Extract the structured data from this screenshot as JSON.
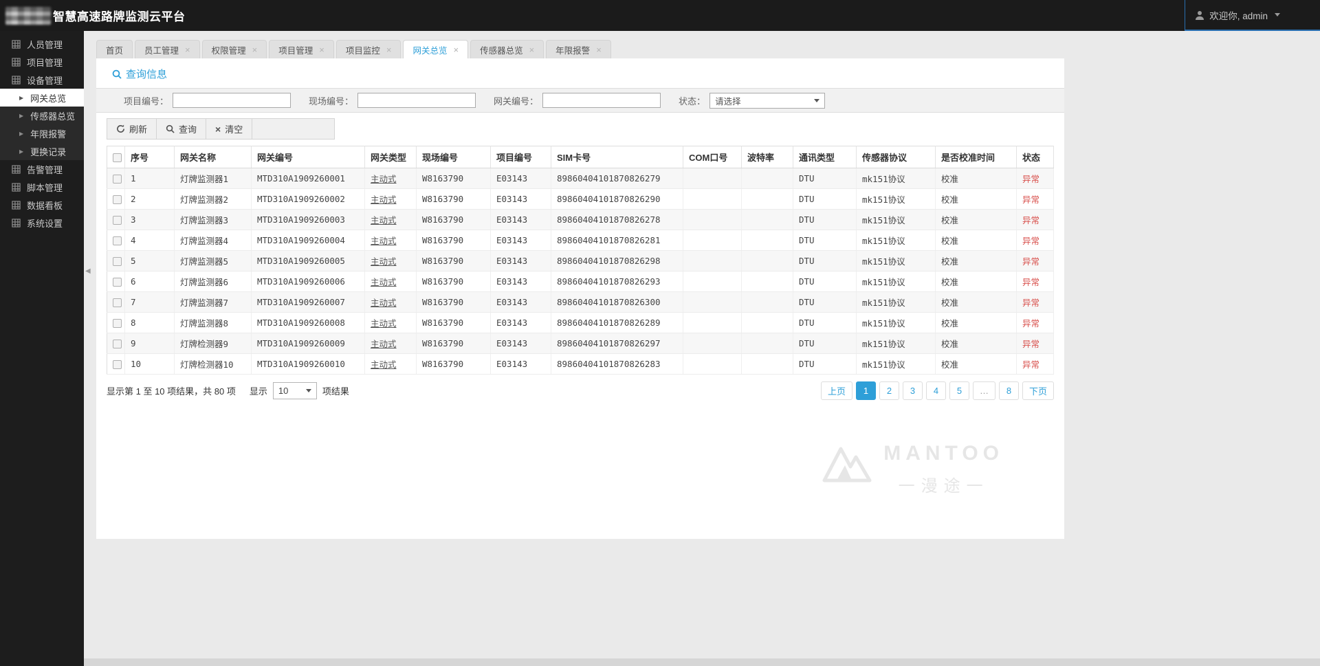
{
  "header": {
    "title": "智慧高速路牌监测云平台",
    "welcome": "欢迎你, admin"
  },
  "sidebar": {
    "items": [
      {
        "label": "人员管理",
        "sub": false,
        "active": false
      },
      {
        "label": "项目管理",
        "sub": false,
        "active": false
      },
      {
        "label": "设备管理",
        "sub": false,
        "active": false
      },
      {
        "label": "网关总览",
        "sub": true,
        "active": true
      },
      {
        "label": "传感器总览",
        "sub": true,
        "active": false
      },
      {
        "label": "年限报警",
        "sub": true,
        "active": false
      },
      {
        "label": "更换记录",
        "sub": true,
        "active": false
      },
      {
        "label": "告警管理",
        "sub": false,
        "active": false
      },
      {
        "label": "脚本管理",
        "sub": false,
        "active": false
      },
      {
        "label": "数据看板",
        "sub": false,
        "active": false
      },
      {
        "label": "系统设置",
        "sub": false,
        "active": false
      }
    ]
  },
  "tabs": [
    {
      "label": "首页",
      "closable": false,
      "active": false
    },
    {
      "label": "员工管理",
      "closable": true,
      "active": false
    },
    {
      "label": "权限管理",
      "closable": true,
      "active": false
    },
    {
      "label": "项目管理",
      "closable": true,
      "active": false
    },
    {
      "label": "项目监控",
      "closable": true,
      "active": false
    },
    {
      "label": "网关总览",
      "closable": true,
      "active": true
    },
    {
      "label": "传感器总览",
      "closable": true,
      "active": false
    },
    {
      "label": "年限报警",
      "closable": true,
      "active": false
    }
  ],
  "query": {
    "section_title": "查询信息",
    "fields": [
      {
        "label": "项目编号：",
        "value": "",
        "placeholder": ""
      },
      {
        "label": "现场编号：",
        "value": "",
        "placeholder": ""
      },
      {
        "label": "网关编号：",
        "value": "",
        "placeholder": ""
      }
    ],
    "status_label": "状态：",
    "status_value": "请选择",
    "buttons": {
      "refresh": "刷新",
      "search": "查询",
      "clear": "清空"
    }
  },
  "table": {
    "columns": [
      "序号",
      "网关名称",
      "网关编号",
      "网关类型",
      "现场编号",
      "项目编号",
      "SIM卡号",
      "COM口号",
      "波特率",
      "通讯类型",
      "传感器协议",
      "是否校准时间",
      "状态"
    ],
    "rows": [
      {
        "no": "1",
        "name": "灯牌监测器1",
        "gateway_no": "MTD310A1909260001",
        "type": "主动式",
        "site_no": "W8163790",
        "project_no": "E03143",
        "sim": "89860404101870826279",
        "com": "",
        "baud": "",
        "comm": "DTU",
        "protocol": "mk151协议",
        "calibrated": "校准",
        "status": "异常"
      },
      {
        "no": "2",
        "name": "灯牌监测器2",
        "gateway_no": "MTD310A1909260002",
        "type": "主动式",
        "site_no": "W8163790",
        "project_no": "E03143",
        "sim": "89860404101870826290",
        "com": "",
        "baud": "",
        "comm": "DTU",
        "protocol": "mk151协议",
        "calibrated": "校准",
        "status": "异常"
      },
      {
        "no": "3",
        "name": "灯牌监测器3",
        "gateway_no": "MTD310A1909260003",
        "type": "主动式",
        "site_no": "W8163790",
        "project_no": "E03143",
        "sim": "89860404101870826278",
        "com": "",
        "baud": "",
        "comm": "DTU",
        "protocol": "mk151协议",
        "calibrated": "校准",
        "status": "异常"
      },
      {
        "no": "4",
        "name": "灯牌监测器4",
        "gateway_no": "MTD310A1909260004",
        "type": "主动式",
        "site_no": "W8163790",
        "project_no": "E03143",
        "sim": "89860404101870826281",
        "com": "",
        "baud": "",
        "comm": "DTU",
        "protocol": "mk151协议",
        "calibrated": "校准",
        "status": "异常"
      },
      {
        "no": "5",
        "name": "灯牌监测器5",
        "gateway_no": "MTD310A1909260005",
        "type": "主动式",
        "site_no": "W8163790",
        "project_no": "E03143",
        "sim": "89860404101870826298",
        "com": "",
        "baud": "",
        "comm": "DTU",
        "protocol": "mk151协议",
        "calibrated": "校准",
        "status": "异常"
      },
      {
        "no": "6",
        "name": "灯牌监测器6",
        "gateway_no": "MTD310A1909260006",
        "type": "主动式",
        "site_no": "W8163790",
        "project_no": "E03143",
        "sim": "89860404101870826293",
        "com": "",
        "baud": "",
        "comm": "DTU",
        "protocol": "mk151协议",
        "calibrated": "校准",
        "status": "异常"
      },
      {
        "no": "7",
        "name": "灯牌监测器7",
        "gateway_no": "MTD310A1909260007",
        "type": "主动式",
        "site_no": "W8163790",
        "project_no": "E03143",
        "sim": "89860404101870826300",
        "com": "",
        "baud": "",
        "comm": "DTU",
        "protocol": "mk151协议",
        "calibrated": "校准",
        "status": "异常"
      },
      {
        "no": "8",
        "name": "灯牌监测器8",
        "gateway_no": "MTD310A1909260008",
        "type": "主动式",
        "site_no": "W8163790",
        "project_no": "E03143",
        "sim": "89860404101870826289",
        "com": "",
        "baud": "",
        "comm": "DTU",
        "protocol": "mk151协议",
        "calibrated": "校准",
        "status": "异常"
      },
      {
        "no": "9",
        "name": "灯牌检测器9",
        "gateway_no": "MTD310A1909260009",
        "type": "主动式",
        "site_no": "W8163790",
        "project_no": "E03143",
        "sim": "89860404101870826297",
        "com": "",
        "baud": "",
        "comm": "DTU",
        "protocol": "mk151协议",
        "calibrated": "校准",
        "status": "异常"
      },
      {
        "no": "10",
        "name": "灯牌检测器10",
        "gateway_no": "MTD310A1909260010",
        "type": "主动式",
        "site_no": "W8163790",
        "project_no": "E03143",
        "sim": "89860404101870826283",
        "com": "",
        "baud": "",
        "comm": "DTU",
        "protocol": "mk151协议",
        "calibrated": "校准",
        "status": "异常"
      }
    ]
  },
  "pagination": {
    "summary": "显示第 1 至 10 项结果，共 80 项",
    "page_size_prefix": "显示",
    "page_size": "10",
    "page_size_suffix": "项结果",
    "prev": "上页",
    "next": "下页",
    "pages": [
      "1",
      "2",
      "3",
      "4",
      "5",
      "…",
      "8"
    ],
    "active_page": "1"
  },
  "watermark": {
    "brand": "MANTOO",
    "subtitle": "一漫途一"
  },
  "colors": {
    "accent": "#2e9fd8",
    "status_error": "#d9534f",
    "header_bg": "#1b1b1b",
    "sidebar_bg": "#1d1d1d"
  }
}
